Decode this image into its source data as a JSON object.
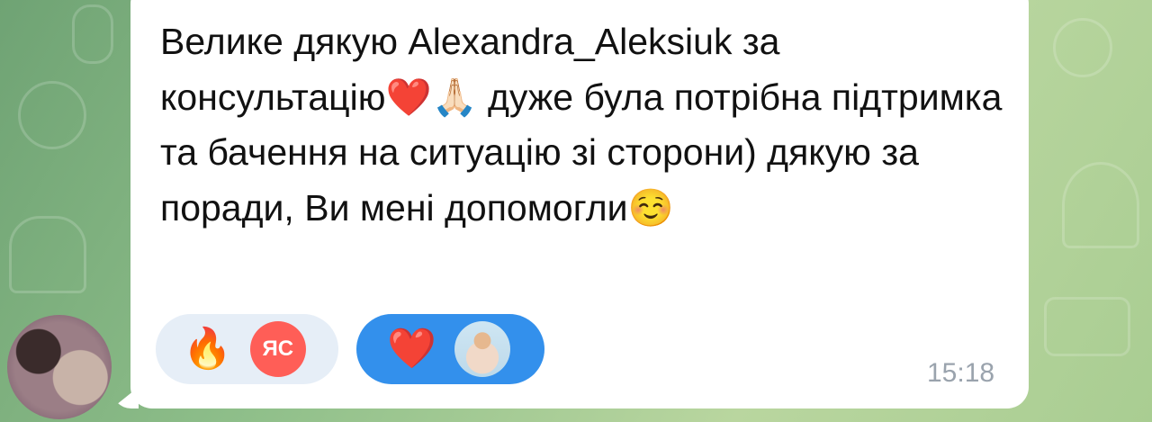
{
  "message": {
    "text": "Велике дякую Alexandra_Aleksiuk за консультацію❤️🙏🏻 дуже була потрібна підтримка та бачення на ситуацію зі сторони) дякую за поради, Ви мені допомогли☺️",
    "time": "15:18"
  },
  "reactions": [
    {
      "emoji": "🔥",
      "reactor_initials": "ЯС",
      "selected": false
    },
    {
      "emoji": "❤️",
      "reactor_initials": "",
      "selected": true
    }
  ],
  "colors": {
    "bubble": "#ffffff",
    "selected_reaction": "#3390ec",
    "unselected_reaction": "#e6eef7",
    "initials_avatar": "#ff5e57",
    "timestamp": "#9aa3ad"
  },
  "icons": {
    "wallpaper": "doodle-pattern",
    "sender_avatar": "avatar-photo"
  }
}
